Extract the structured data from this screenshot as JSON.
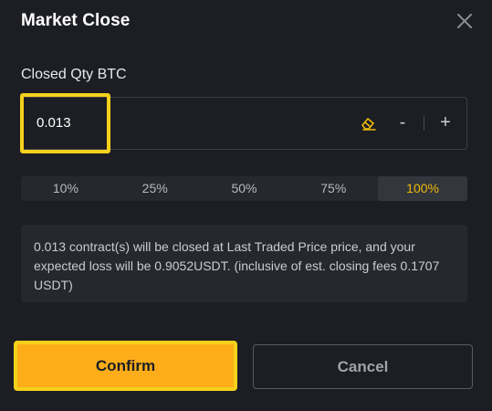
{
  "dialog": {
    "title": "Market Close",
    "close_icon": "close-icon"
  },
  "qty": {
    "label": "Closed Qty BTC",
    "value": "0.013",
    "clear_icon": "eraser-icon",
    "minus": "-",
    "plus": "+"
  },
  "percent_options": [
    {
      "label": "10%"
    },
    {
      "label": "25%"
    },
    {
      "label": "50%"
    },
    {
      "label": "75%"
    },
    {
      "label": "100%",
      "selected": true
    }
  ],
  "info": {
    "text": "0.013 contract(s) will be closed at Last Traded Price price, and your expected loss will be 0.9052USDT. (inclusive of est. closing fees 0.1707 USDT)"
  },
  "buttons": {
    "confirm": "Confirm",
    "cancel": "Cancel"
  },
  "colors": {
    "accent": "#fcad19",
    "highlight": "#f5d11b",
    "background": "#1c1e24"
  }
}
